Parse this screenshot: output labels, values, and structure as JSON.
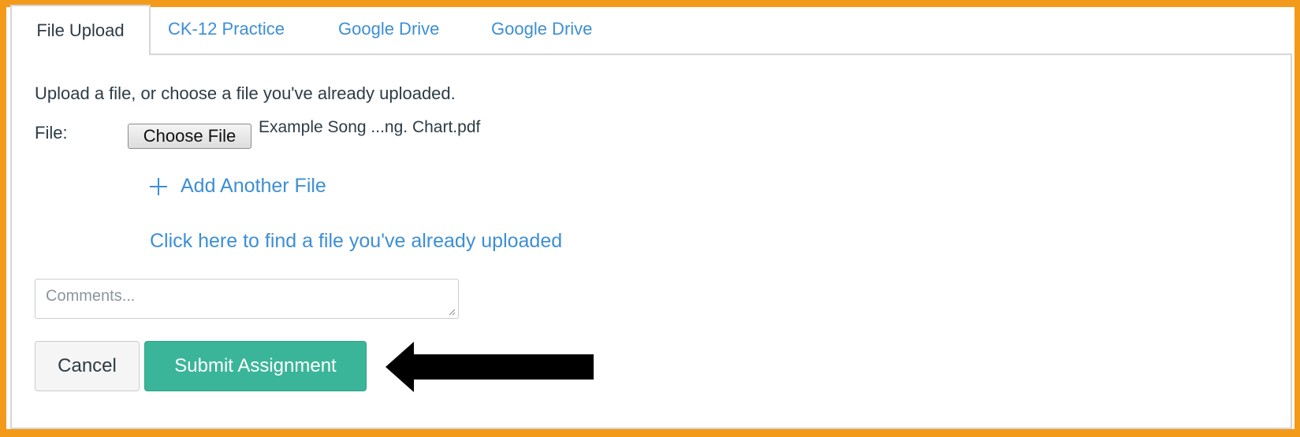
{
  "tabs": [
    {
      "label": "File Upload"
    },
    {
      "label": "CK-12 Practice"
    },
    {
      "label": "Google Drive"
    },
    {
      "label": "Google Drive"
    }
  ],
  "upload": {
    "intro_text": "Upload a file, or choose a file you've already uploaded.",
    "file_label": "File:",
    "choose_file_label": "Choose File",
    "selected_file_name": "Example Song ...ng. Chart.pdf",
    "add_another_label": "Add Another File",
    "find_uploaded_link": "Click here to find a file you've already uploaded"
  },
  "comments": {
    "placeholder": "Comments...",
    "value": ""
  },
  "actions": {
    "cancel_label": "Cancel",
    "submit_label": "Submit Assignment"
  },
  "colors": {
    "frame": "#f49a1a",
    "link": "#3d8fd4",
    "submit": "#3bb59a",
    "arrow": "#000000"
  },
  "icons": {
    "add": "plus-icon",
    "pointer": "left-arrow-icon",
    "resize": "resize-handle-icon"
  }
}
